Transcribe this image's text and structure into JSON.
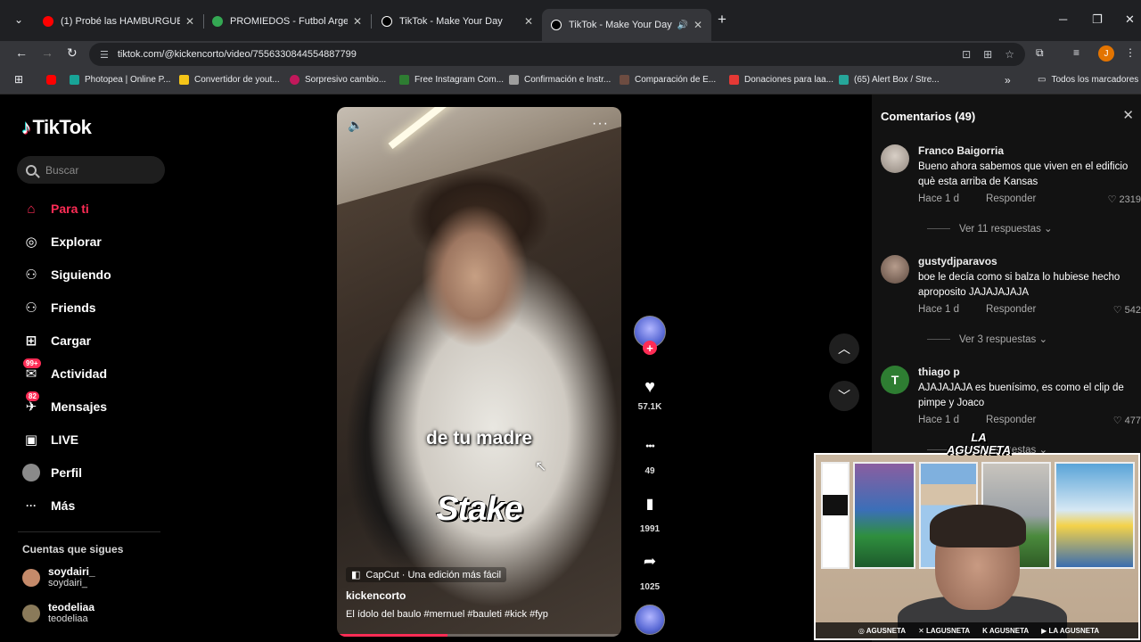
{
  "tabs": [
    {
      "title": "(1) Probé las HAMBURGUESAS",
      "close": "✕",
      "color": "#ff0000"
    },
    {
      "title": "PROMIEDOS - Futbol Argentino",
      "close": "✕",
      "color": "#34a853"
    },
    {
      "title": "TikTok - Make Your Day",
      "close": "✕",
      "color": "#ffffff"
    },
    {
      "title": "TikTok - Make Your Day",
      "close": "✕",
      "color": "#ffffff"
    }
  ],
  "browser": {
    "url": "tiktok.com/@kickencorto/video/7556330844554887799",
    "tab_list_icon": "⌄",
    "new_tab": "+",
    "minimize": "─",
    "maximize": "❐",
    "close": "✕",
    "back": "←",
    "forward": "→",
    "reload": "↻",
    "profile_initial": "J",
    "audio_icon": "🔊"
  },
  "bookmarks": [
    {
      "label": "",
      "color": "#ff0000"
    },
    {
      "label": "Photopea | Online P...",
      "color": "#18a497"
    },
    {
      "label": "Convertidor de yout...",
      "color": "#f5c518"
    },
    {
      "label": "Sorpresivo cambio...",
      "color": "#c2185b"
    },
    {
      "label": "Free Instagram Com...",
      "color": "#2e7d32"
    },
    {
      "label": "Confirmación e Instr...",
      "color": "#9e9e9e"
    },
    {
      "label": "Comparación de E...",
      "color": "#6d4c41"
    },
    {
      "label": "Donaciones para laa...",
      "color": "#e53935"
    },
    {
      "label": "(65) Alert Box / Stre...",
      "color": "#26a69a"
    }
  ],
  "bookmarks_all": "Todos los marcadores",
  "bookmarks_more": "»",
  "tiktok": {
    "logo": "TikTok",
    "search_placeholder": "Buscar",
    "nav": [
      {
        "label": "Para ti",
        "icon": "⌂",
        "active": true
      },
      {
        "label": "Explorar",
        "icon": "◎"
      },
      {
        "label": "Siguiendo",
        "icon": "⚇"
      },
      {
        "label": "Friends",
        "icon": "⚇"
      },
      {
        "label": "Cargar",
        "icon": "⊞"
      },
      {
        "label": "Actividad",
        "icon": "✉",
        "badge": "99+"
      },
      {
        "label": "Mensajes",
        "icon": "✈",
        "badge": "82"
      },
      {
        "label": "LIVE",
        "icon": "▣"
      },
      {
        "label": "Perfil",
        "icon": "●"
      },
      {
        "label": "Más",
        "icon": "···"
      }
    ],
    "following_title": "Cuentas que sigues",
    "following": [
      {
        "name": "soydairi_",
        "handle": "soydairi_",
        "color": "#c58a6a"
      },
      {
        "name": "teodeliaa",
        "handle": "teodeliaa",
        "color": "#8a7a5a"
      }
    ]
  },
  "video": {
    "overlay_text": "de tu madre",
    "brand_text": "Stake",
    "capcut": "CapCut · Una edición más fácil",
    "author": "kickencorto",
    "description": "El ídolo del baulo #mernuel #bauleti #kick #fyp",
    "progress": 0.39,
    "mute_icon": "🔈",
    "more_icon": "···",
    "cursor": "↖"
  },
  "actions": {
    "likes": "57.1K",
    "comments": "49",
    "saves": "1991",
    "shares": "1025",
    "like_icon": "♥",
    "comment_icon": "●●●",
    "save_icon": "▮",
    "share_icon": "➦",
    "plus": "+"
  },
  "scroll": {
    "up": "︿",
    "down": "﹀"
  },
  "comments": {
    "title": "Comentarios (49)",
    "close": "✕",
    "items": [
      {
        "name": "Franco Baigorria",
        "text": "Bueno ahora sabemos que viven en el edificio què esta arriba de Kansas",
        "time": "Hace 1 d",
        "reply": "Responder",
        "likes": "♡ 2319",
        "replies": "Ver 11 respuestas ⌄",
        "avatar": "#9a8f85"
      },
      {
        "name": "gustydjparavos",
        "text": "boe le decía como si balza lo hubiese hecho aproposito JAJAJAJAJA",
        "time": "Hace 1 d",
        "reply": "Responder",
        "likes": "♡ 542",
        "replies": "Ver 3 respuestas ⌄",
        "avatar": "#7a6558"
      },
      {
        "name": "thiago p",
        "text": "AJAJAJAJA es buenísimo, es como el clip de pimpe y Joaco",
        "time": "Hace 1 d",
        "reply": "Responder",
        "likes": "♡ 477",
        "replies": "Ver 2 respuestas ⌄",
        "avatar": "#2e7d32",
        "initial": "T"
      }
    ]
  },
  "stream": {
    "logo_line1": "LA",
    "logo_line2": "AGUSNETA",
    "socials": [
      "◎ AGUSNETA",
      "✕ LAGUSNETA",
      "K AGUSNETA",
      "▶ LA AGUSNETA"
    ]
  }
}
